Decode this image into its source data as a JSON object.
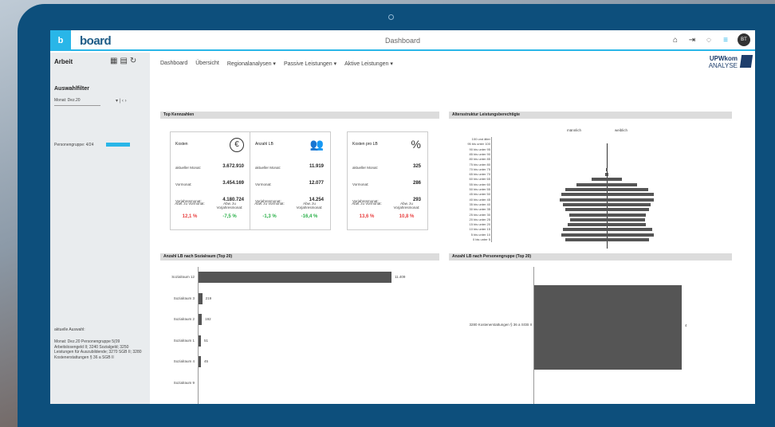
{
  "app": {
    "logo_letter": "b",
    "logo_text": "board",
    "title": "Dashboard",
    "avatar": "BT"
  },
  "sidebar": {
    "title": "Arbeit",
    "filter_heading": "Auswahlfilter",
    "month_select": "Monat: Dez.20",
    "personengruppe": "Personengruppe: 4/24",
    "current_selection_heading": "aktuelle Auswahl:",
    "current_selection_text": "Monat: Dez.20 Personengruppe 5(09 Arbeitslosengeld II; 3240 Sozialgeld; 3250 Leistungen für Auszubildende; 3270 SGB II; 3280 Kostenerstattungen § 36 a SGB II"
  },
  "nav": [
    {
      "label": "Dashboard"
    },
    {
      "label": "Übersicht"
    },
    {
      "label": "Regionalanalysen ▾"
    },
    {
      "label": "Passive Leistungen ▾"
    },
    {
      "label": "Aktive Leistungen ▾"
    }
  ],
  "brand": {
    "name": "UPWkom",
    "sub": "ANALYSE"
  },
  "sections": {
    "top": "Top Kennzahlen",
    "pyramid": "Altersstruktur Leistungsberechtigte",
    "sozial": "Anzahl LB nach Sozialraum (Top 20)",
    "personen": "Anzahl LB nach Personengruppe (Top 20)"
  },
  "cards": [
    {
      "title": "Kosten",
      "icon": "€",
      "rows": [
        {
          "label": "aktueller Monat:",
          "value": "3.672.910"
        },
        {
          "label": "Vormonat:",
          "value": "3.454.169"
        },
        {
          "label": "Vorjahresmonat:",
          "value": "4.180.724"
        }
      ],
      "d1_label": "Abw. zu Vormonat:",
      "d1": "12,1 %",
      "d2_label": "Abw. zu Vorjahresmonat:",
      "d2": "-7,5 %"
    },
    {
      "title": "Anzahl LB",
      "icon": "👥",
      "rows": [
        {
          "label": "aktueller Monat:",
          "value": "11.919"
        },
        {
          "label": "Vormonat:",
          "value": "12.077"
        },
        {
          "label": "Vorjahresmonat:",
          "value": "14.254"
        }
      ],
      "d1_label": "Abw. zu Vormonat:",
      "d1": "-1,3 %",
      "d2_label": "Abw. zu Vorjahresmonat:",
      "d2": "-16,4 %"
    },
    {
      "title": "Kosten pro LB",
      "icon": "%",
      "rows": [
        {
          "label": "aktueller Monat:",
          "value": "325"
        },
        {
          "label": "Vormonat:",
          "value": "286"
        },
        {
          "label": "Vorjahresmonat:",
          "value": "293"
        }
      ],
      "d1_label": "Abw. zu Vormonat:",
      "d1": "13,6 %",
      "d2_label": "Abw. zu Vorjahresmonat:",
      "d2": "10,8 %"
    }
  ],
  "pyramid": {
    "legend_left": "männlich",
    "legend_right": "weiblich",
    "ages": [
      "100 und älter",
      "95 bis unter 100",
      "90 bis unter 95",
      "85 bis unter 90",
      "80 bis unter 85",
      "75 bis unter 80",
      "70 bis unter 75",
      "65 bis unter 70",
      "60 bis unter 65",
      "55 bis unter 60",
      "50 bis unter 55",
      "45 bis unter 50",
      "40 bis unter 45",
      "35 bis unter 40",
      "30 bis unter 35",
      "25 bis unter 30",
      "20 bis unter 25",
      "15 bis unter 20",
      "10 bis unter 15",
      "5 bis unter 10",
      "0 bis unter 5"
    ],
    "male": [
      0,
      0,
      0,
      0,
      0,
      0,
      1,
      2,
      20,
      40,
      55,
      60,
      62,
      58,
      55,
      50,
      48,
      52,
      58,
      60,
      55
    ],
    "female": [
      0,
      0,
      0,
      0,
      0,
      0,
      1,
      2,
      20,
      40,
      55,
      62,
      62,
      58,
      56,
      52,
      50,
      52,
      60,
      62,
      56
    ]
  },
  "chart_data": [
    {
      "type": "bar",
      "title": "Anzahl LB nach Sozialraum (Top 20)",
      "categories": [
        "Sozialraum 12",
        "Sozialraum 3",
        "Sozialraum 2",
        "Sozialraum 1",
        "Sozialraum 4",
        "Sozialraum 9"
      ],
      "values": [
        11409,
        219,
        192,
        51,
        45,
        0
      ],
      "value_labels": [
        "11.409",
        "219",
        "192",
        "51",
        "45",
        ""
      ]
    },
    {
      "type": "bar",
      "title": "Anzahl LB nach Personengruppe (Top 20)",
      "categories": [
        "3280 Kostenerstattungen § 36 a SGB II"
      ],
      "values": [
        4
      ],
      "value_labels": [
        "4"
      ]
    }
  ]
}
